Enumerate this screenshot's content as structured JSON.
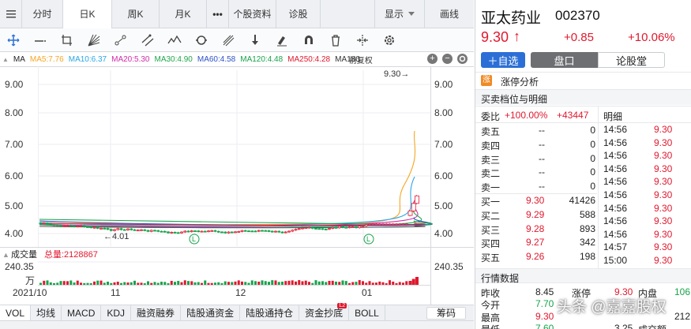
{
  "top_tabs": [
    {
      "label": "分时",
      "active": false
    },
    {
      "label": "日K",
      "active": true
    },
    {
      "label": "周K",
      "active": false
    },
    {
      "label": "月K",
      "active": false
    },
    {
      "label": "•••",
      "active": false
    },
    {
      "label": "个股资料",
      "active": false
    },
    {
      "label": "诊股",
      "active": false
    },
    {
      "label": "显示",
      "active": false
    },
    {
      "label": "画线",
      "active": false
    }
  ],
  "tools": [
    "crosshair-icon",
    "horizontal-line-icon",
    "crop-icon",
    "fan-icon",
    "ray-icon",
    "eraser-line-icon",
    "wave-icon",
    "cycle-icon",
    "fork-icon",
    "arrow-down-icon",
    "eraser-icon",
    "magnet-icon",
    "trash-icon",
    "split-icon",
    "settings-icon"
  ],
  "ma": {
    "label": "MA",
    "items": [
      {
        "text": "MA5:7.76",
        "color": "#f5a623"
      },
      {
        "text": "MA10:6.37",
        "color": "#2ba6e6"
      },
      {
        "text": "MA20:5.30",
        "color": "#d02ca8"
      },
      {
        "text": "MA30:4.90",
        "color": "#1fa64b"
      },
      {
        "text": "MA60:4.58",
        "color": "#2b52c8"
      },
      {
        "text": "MA120:4.48",
        "color": "#17a34a"
      },
      {
        "text": "MA250:4.28",
        "color": "#e0192e"
      },
      {
        "text": "MA180",
        "color": "#333333"
      }
    ],
    "adjust": "前复权"
  },
  "chart_data": {
    "type": "candlestick",
    "price_axis": [
      "9.00",
      "8.00",
      "7.00",
      "6.00",
      "5.00",
      "4.00"
    ],
    "date_labels": [
      "2021/10",
      "11",
      "12",
      "01"
    ],
    "high_marker": "9.30→",
    "low_marker": "←4.01",
    "volume_label": "成交量",
    "volume_total": "总量:2128867",
    "volume_axis": "240.35",
    "volume_unit": "万",
    "l_markers": [
      "L",
      "L"
    ]
  },
  "stock": {
    "name": "亚太药业",
    "code": "002370",
    "price": "9.30",
    "arrow": "↑",
    "change": "+0.85",
    "change_pct": "+10.06%"
  },
  "actions": {
    "add": "＋自选",
    "pankou": "盘口",
    "forum": "论股堂"
  },
  "limit_up": "涨停分析",
  "book_title": "买卖档位与明细",
  "weibi": {
    "label": "委比",
    "pct": "+100.00%",
    "diff": "+43447"
  },
  "detail_title": "明细",
  "order_book": [
    {
      "side": "卖五",
      "price": "--",
      "vol": "0"
    },
    {
      "side": "卖四",
      "price": "--",
      "vol": "0"
    },
    {
      "side": "卖三",
      "price": "--",
      "vol": "0"
    },
    {
      "side": "卖二",
      "price": "--",
      "vol": "0"
    },
    {
      "side": "卖一",
      "price": "--",
      "vol": "0"
    },
    {
      "side": "买一",
      "price": "9.30",
      "vol": "41426"
    },
    {
      "side": "买二",
      "price": "9.29",
      "vol": "588"
    },
    {
      "side": "买三",
      "price": "9.28",
      "vol": "893"
    },
    {
      "side": "买四",
      "price": "9.27",
      "vol": "342"
    },
    {
      "side": "买五",
      "price": "9.26",
      "vol": "198"
    }
  ],
  "trades": [
    {
      "time": "14:56",
      "price": "9.30"
    },
    {
      "time": "14:56",
      "price": "9.30"
    },
    {
      "time": "14:56",
      "price": "9.30"
    },
    {
      "time": "14:56",
      "price": "9.30"
    },
    {
      "time": "14:56",
      "price": "9.30"
    },
    {
      "time": "14:56",
      "price": "9.30"
    },
    {
      "time": "14:56",
      "price": "9.30"
    },
    {
      "time": "14:56",
      "price": "9.30"
    },
    {
      "time": "14:56",
      "price": "9.30"
    },
    {
      "time": "14:57",
      "price": "9.30"
    },
    {
      "time": "15:00",
      "price": "9.30"
    }
  ],
  "market_title": "行情数据",
  "market": {
    "r1": {
      "k1": "昨收",
      "v1": "8.45",
      "k2": "涨停",
      "v2": "9.30",
      "k3": "内盘",
      "v3": "106"
    },
    "r2": {
      "k1": "今开",
      "v1": "7.70",
      "k2": "",
      "v2": "",
      "k3": "",
      "v3": ""
    },
    "r3": {
      "k1": "最高",
      "v1": "9.30",
      "k2": "",
      "v2": "",
      "k3": "",
      "v3": "212"
    },
    "r4": {
      "k1": "最低",
      "v1": "7.60",
      "k2": "",
      "v2": "3.25",
      "k3": "成交额",
      "v3": ""
    }
  },
  "indicator_tabs": [
    {
      "label": "VOL",
      "active": true
    },
    {
      "label": "均线",
      "active": false
    },
    {
      "label": "MACD",
      "active": false
    },
    {
      "label": "KDJ",
      "active": false
    },
    {
      "label": "融资融券",
      "active": false
    },
    {
      "label": "陆股通资金",
      "active": false
    },
    {
      "label": "陆股通持仓",
      "active": false
    },
    {
      "label": "资金抄底",
      "active": false,
      "badge": "L2"
    },
    {
      "label": "BOLL",
      "active": false
    }
  ],
  "chips_label": "筹码",
  "watermark": "头条 @嘉嘉股权"
}
